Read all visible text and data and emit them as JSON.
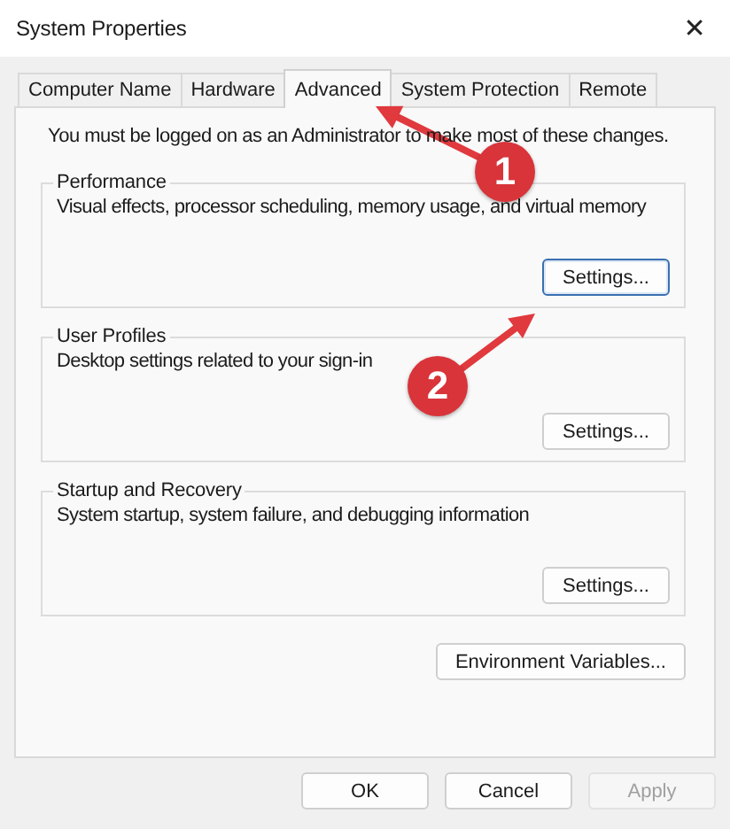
{
  "window": {
    "title": "System Properties",
    "close": "✕"
  },
  "tabs": [
    {
      "label": "Computer Name",
      "selected": false
    },
    {
      "label": "Hardware",
      "selected": false
    },
    {
      "label": "Advanced",
      "selected": true
    },
    {
      "label": "System Protection",
      "selected": false
    },
    {
      "label": "Remote",
      "selected": false
    }
  ],
  "notice": "You must be logged on as an Administrator to make most of these changes.",
  "groups": [
    {
      "title": "Performance",
      "description": "Visual effects, processor scheduling, memory usage, and virtual memory",
      "button": {
        "label": "Settings...",
        "focused": true
      }
    },
    {
      "title": "User Profiles",
      "description": "Desktop settings related to your sign-in",
      "button": {
        "label": "Settings...",
        "focused": false
      }
    },
    {
      "title": "Startup and Recovery",
      "description": "System startup, system failure, and debugging information",
      "button": {
        "label": "Settings...",
        "focused": false
      }
    }
  ],
  "environment_button": {
    "label": "Environment Variables..."
  },
  "footer_buttons": [
    {
      "label": "OK",
      "disabled": false
    },
    {
      "label": "Cancel",
      "disabled": false
    },
    {
      "label": "Apply",
      "disabled": true
    }
  ],
  "annotations": [
    {
      "number": "1"
    },
    {
      "number": "2"
    }
  ]
}
